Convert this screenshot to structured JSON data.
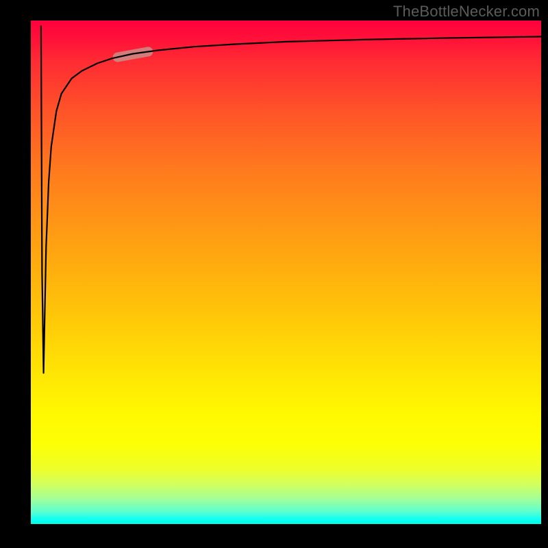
{
  "watermark": "TheBottleNecker.com",
  "chart_data": {
    "type": "line",
    "title": "",
    "xlabel": "",
    "ylabel": "",
    "xlim": [
      0,
      100
    ],
    "ylim": [
      0,
      100
    ],
    "grid": false,
    "background_gradient": {
      "direction": "vertical",
      "stops": [
        {
          "pos": 0,
          "color": "#ff003e"
        },
        {
          "pos": 50,
          "color": "#ffb80e"
        },
        {
          "pos": 80,
          "color": "#fff801"
        },
        {
          "pos": 100,
          "color": "#00ffe6"
        }
      ]
    },
    "series": [
      {
        "name": "bottleneck-curve",
        "color": "#000000",
        "x": [
          2.0,
          2.2,
          2.5,
          3.0,
          3.5,
          4.0,
          5.0,
          6.0,
          8.0,
          10.0,
          13.0,
          16.0,
          20.0,
          25.0,
          32.0,
          40.0,
          50.0,
          65.0,
          80.0,
          100.0
        ],
        "y": [
          99.0,
          50.0,
          30.0,
          55.0,
          68.0,
          75.0,
          82.0,
          85.5,
          88.5,
          90.0,
          91.5,
          92.5,
          93.4,
          94.1,
          94.8,
          95.3,
          95.8,
          96.2,
          96.5,
          96.8
        ]
      }
    ],
    "highlight": {
      "series": "bottleneck-curve",
      "x_range": [
        17,
        23
      ],
      "color": "#c98e87",
      "thickness_px": 14
    }
  }
}
